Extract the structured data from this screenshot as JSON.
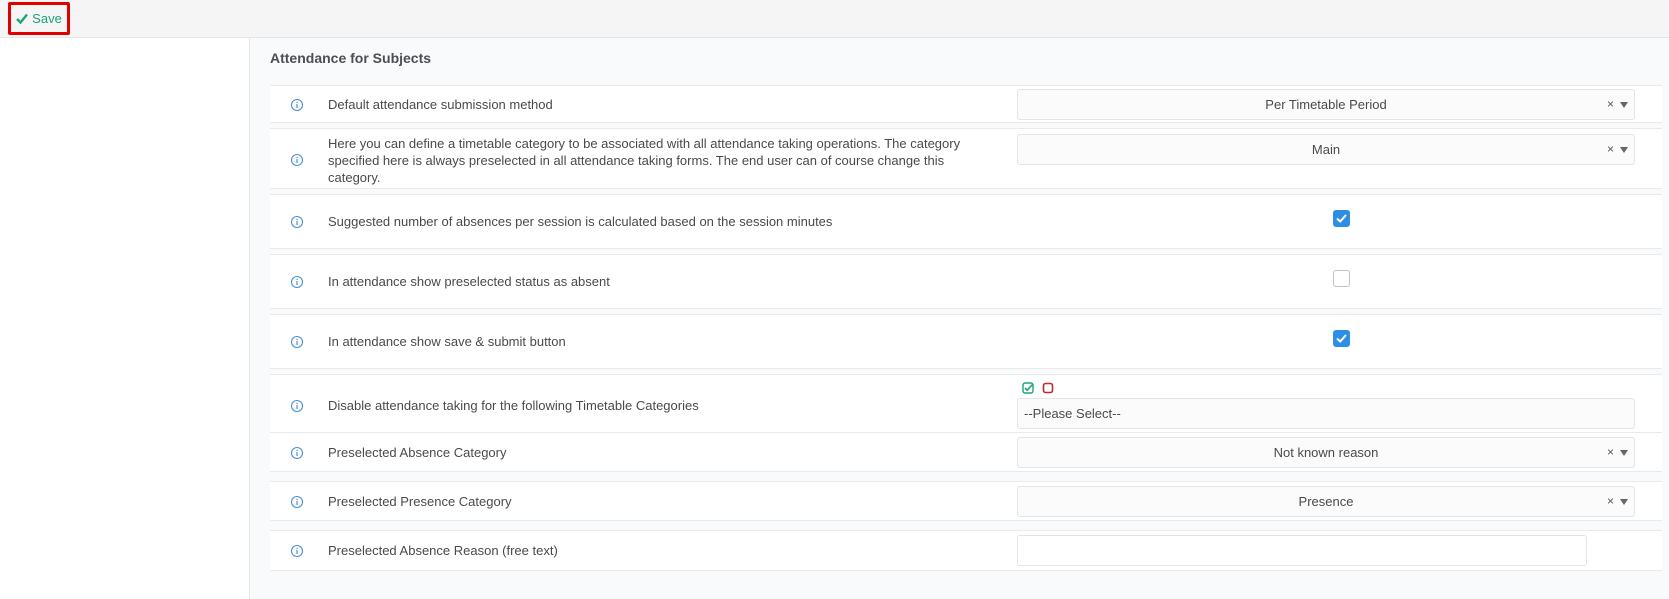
{
  "toolbar": {
    "save_label": "Save"
  },
  "section": {
    "title": "Attendance for Subjects"
  },
  "rows": [
    {
      "label": "Default attendance submission method",
      "value": "Per Timetable Period"
    },
    {
      "label": "Here you can define a timetable category to be associated with all attendance taking operations. The category specified here is always preselected in all attendance taking forms. The end user can of course change this category.",
      "value": "Main"
    },
    {
      "label": "Suggested number of absences per session is calculated based on the session minutes",
      "checked": true
    },
    {
      "label": "In attendance show preselected status as absent",
      "checked": false
    },
    {
      "label": "In attendance show save & submit button",
      "checked": true
    },
    {
      "label": "Disable attendance taking for the following Timetable Categories",
      "placeholder": "--Please Select--"
    },
    {
      "label": "Preselected Absence Category",
      "value": "Not known reason"
    },
    {
      "label": "Preselected Presence Category",
      "value": "Presence"
    },
    {
      "label": "Preselected Absence Reason (free text)",
      "value": ""
    }
  ],
  "clear_symbol": "×",
  "colors": {
    "accent": "#1aa37a",
    "checkbox": "#2f8ee3",
    "annotation": "#e00000",
    "deselect": "#c0282d"
  }
}
